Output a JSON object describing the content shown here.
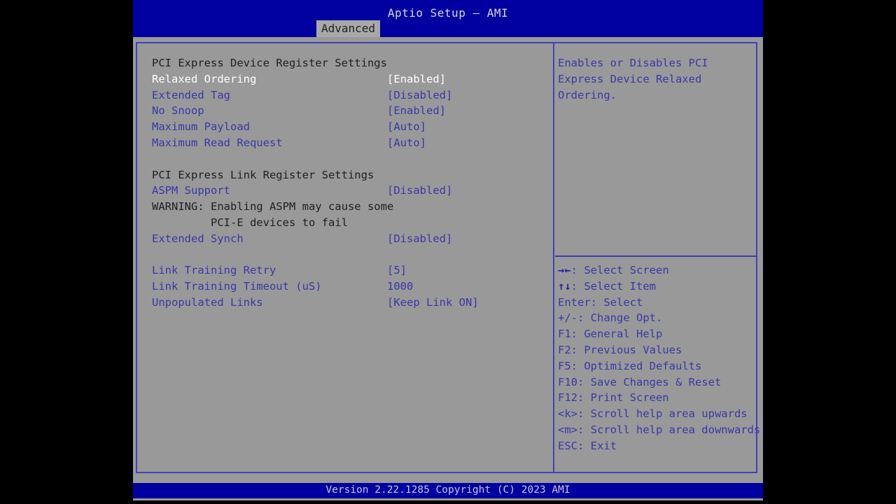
{
  "header": {
    "title": "Aptio Setup – AMI",
    "tabs": [
      {
        "label": "Advanced",
        "active": true
      }
    ]
  },
  "settings": {
    "rows": [
      {
        "kind": "header",
        "label": "PCI Express Device Register Settings",
        "value": ""
      },
      {
        "kind": "selected",
        "label": "Relaxed Ordering",
        "value": "[Enabled]"
      },
      {
        "kind": "item",
        "label": "Extended Tag",
        "value": "[Disabled]"
      },
      {
        "kind": "item",
        "label": "No Snoop",
        "value": "[Enabled]"
      },
      {
        "kind": "item",
        "label": "Maximum Payload",
        "value": "[Auto]"
      },
      {
        "kind": "item",
        "label": "Maximum Read Request",
        "value": "[Auto]"
      },
      {
        "kind": "spacer",
        "label": "",
        "value": ""
      },
      {
        "kind": "header",
        "label": "PCI Express Link Register Settings",
        "value": ""
      },
      {
        "kind": "item",
        "label": "ASPM Support",
        "value": "[Disabled]"
      },
      {
        "kind": "warn",
        "label": "WARNING: Enabling ASPM may cause some",
        "value": ""
      },
      {
        "kind": "warn",
        "label": "         PCI-E devices to fail",
        "value": ""
      },
      {
        "kind": "item",
        "label": "Extended Synch",
        "value": "[Disabled]"
      },
      {
        "kind": "spacer",
        "label": "",
        "value": ""
      },
      {
        "kind": "item",
        "label": "Link Training Retry",
        "value": "[5]"
      },
      {
        "kind": "item",
        "label": "Link Training Timeout (uS)",
        "value": "1000"
      },
      {
        "kind": "item",
        "label": "Unpopulated Links",
        "value": "[Keep Link ON]"
      }
    ]
  },
  "help": {
    "text": "Enables or Disables PCI\nExpress Device Relaxed\nOrdering."
  },
  "keys": {
    "items": [
      {
        "glyph": "→←",
        "text": ": Select Screen"
      },
      {
        "glyph": "↑↓",
        "text": ": Select Item"
      },
      {
        "glyph": "",
        "text": "Enter: Select"
      },
      {
        "glyph": "",
        "text": "+/-: Change Opt."
      },
      {
        "glyph": "",
        "text": "F1: General Help"
      },
      {
        "glyph": "",
        "text": "F2: Previous Values"
      },
      {
        "glyph": "",
        "text": "F5: Optimized Defaults"
      },
      {
        "glyph": "",
        "text": "F10: Save Changes & Reset"
      },
      {
        "glyph": "",
        "text": "F12: Print Screen"
      },
      {
        "glyph": "",
        "text": "<k>: Scroll help area upwards"
      },
      {
        "glyph": "",
        "text": "<m>: Scroll help area downwards"
      },
      {
        "glyph": "",
        "text": "ESC: Exit"
      }
    ]
  },
  "footer": {
    "version": "Version 2.22.1285 Copyright (C) 2023 AMI"
  },
  "colors": {
    "background": "#999999",
    "chrome_blue": "#0000a0",
    "border_blue": "#4040c0",
    "item_text": "#3838a8",
    "header_text": "#202020",
    "selected_text": "#ffffff"
  }
}
